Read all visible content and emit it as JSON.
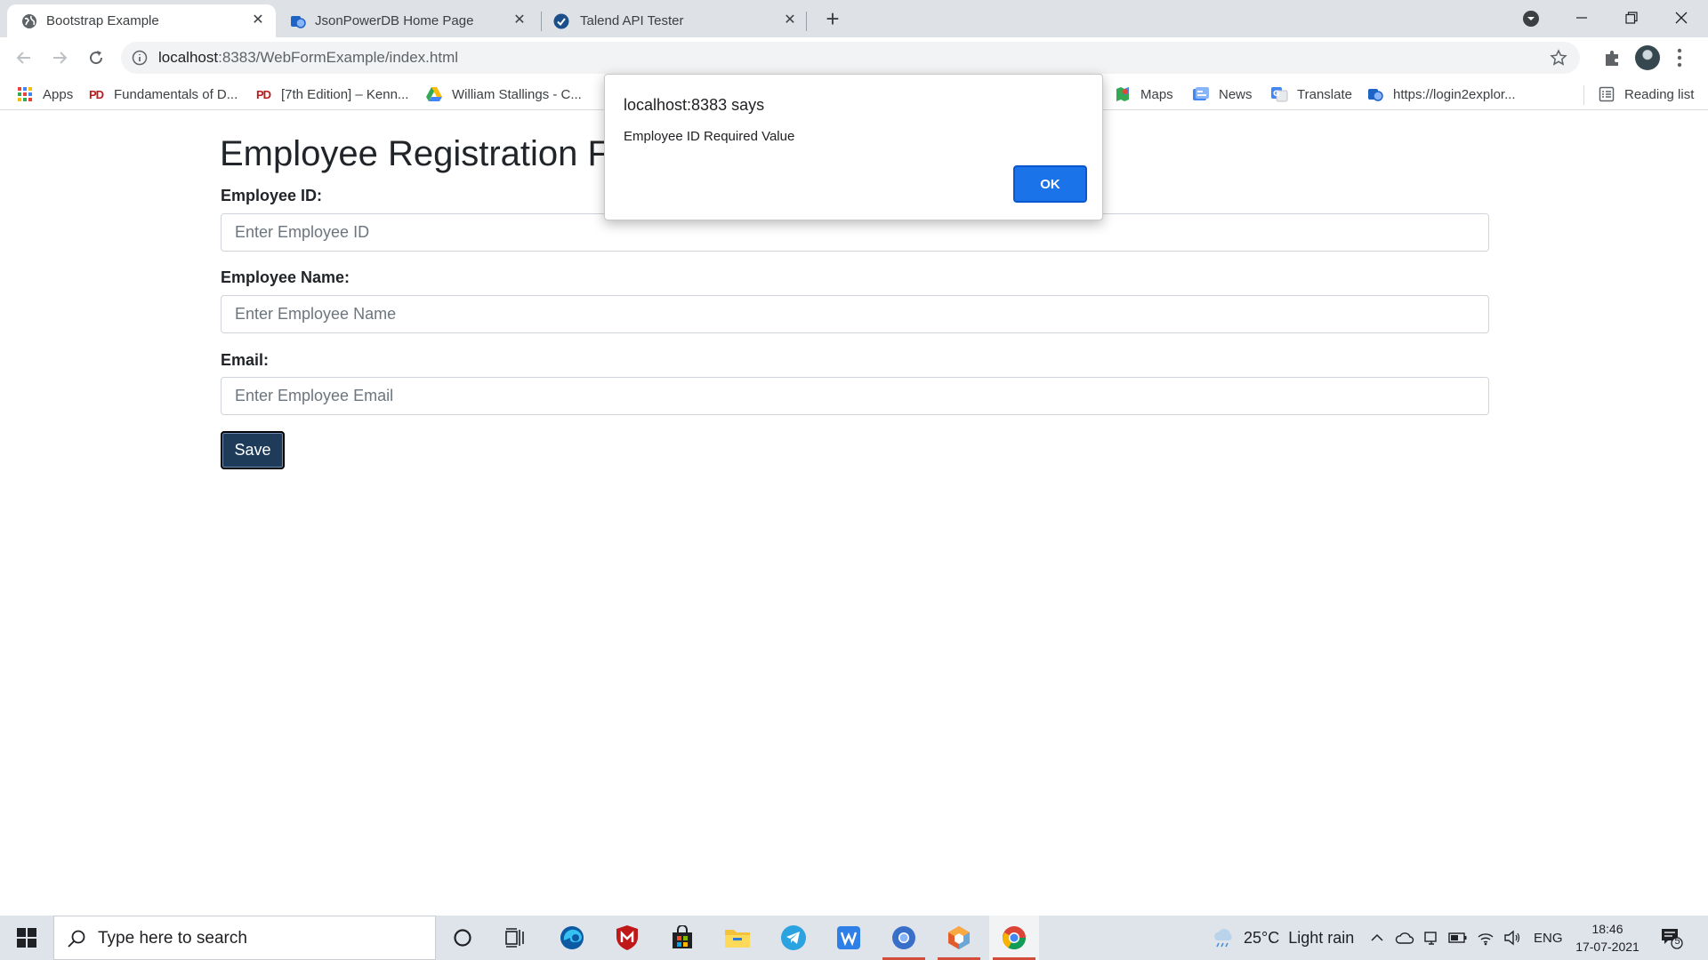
{
  "browser": {
    "tabs": [
      {
        "title": "Bootstrap Example",
        "icon": "globe-icon",
        "active": true
      },
      {
        "title": "JsonPowerDB Home Page",
        "icon": "jsonpowerdb-icon",
        "active": false
      },
      {
        "title": "Talend API Tester",
        "icon": "talend-check-icon",
        "active": false
      }
    ],
    "url_host": "localhost",
    "url_path": ":8383/WebFormExample/index.html",
    "bookmarks": [
      {
        "label": "Apps",
        "icon": "apps-grid-icon"
      },
      {
        "label": "Fundamentals of D...",
        "icon": "pdf-icon"
      },
      {
        "label": "[7th Edition] – Kenn...",
        "icon": "pdf-icon"
      },
      {
        "label": "William Stallings - C...",
        "icon": "google-drive-icon"
      },
      {
        "label": "Maps",
        "icon": "maps-icon"
      },
      {
        "label": "News",
        "icon": "news-icon"
      },
      {
        "label": "Translate",
        "icon": "translate-icon"
      },
      {
        "label": "https://login2explor...",
        "icon": "jsonpowerdb-icon"
      },
      {
        "label": "Reading list",
        "icon": "reading-list-icon"
      }
    ]
  },
  "page": {
    "title": "Employee Registration Fo",
    "fields": [
      {
        "label": "Employee ID:",
        "placeholder": "Enter Employee ID",
        "value": ""
      },
      {
        "label": "Employee Name:",
        "placeholder": "Enter Employee Name",
        "value": ""
      },
      {
        "label": "Email:",
        "placeholder": "Enter Employee Email",
        "value": ""
      }
    ],
    "save_label": "Save"
  },
  "dialog": {
    "title": "localhost:8383 says",
    "message": "Employee ID Required Value",
    "ok_label": "OK"
  },
  "taskbar": {
    "search_placeholder": "Type here to search",
    "weather_temp": "25°C",
    "weather_text": "Light rain",
    "language": "ENG",
    "time": "18:46",
    "date": "17-07-2021",
    "notification_count": "5"
  },
  "colors": {
    "save_button": "#1f3b5a",
    "ok_button": "#1a73e8",
    "tabstrip": "#dee1e6",
    "taskbar": "#dfe3ea"
  }
}
